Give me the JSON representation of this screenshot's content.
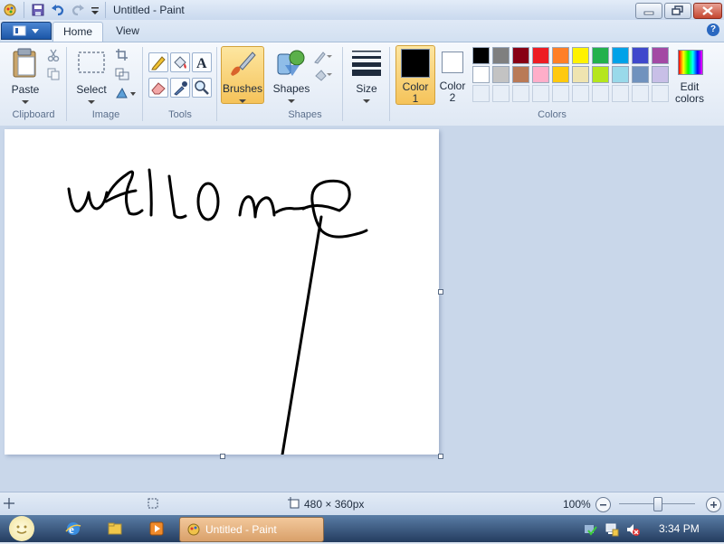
{
  "window": {
    "title": "Untitled - Paint"
  },
  "tabs": [
    {
      "label": "Home",
      "active": true
    },
    {
      "label": "View",
      "active": false
    }
  ],
  "ribbon": {
    "clipboard": {
      "paste_label": "Paste",
      "group_label": "Clipboard"
    },
    "image": {
      "select_label": "Select",
      "group_label": "Image"
    },
    "tools": {
      "group_label": "Tools"
    },
    "brushes": {
      "label": "Brushes"
    },
    "shapes": {
      "label": "Shapes",
      "group_label": "Shapes"
    },
    "size": {
      "label": "Size"
    },
    "colors": {
      "color1_label": "Color",
      "color1_num": "1",
      "color2_label": "Color",
      "color2_num": "2",
      "edit_label_1": "Edit",
      "edit_label_2": "colors",
      "group_label": "Colors",
      "color1_value": "#000000",
      "color2_value": "#ffffff",
      "palette_row1": [
        "#000000",
        "#7f7f7f",
        "#880015",
        "#ed1c24",
        "#ff7f27",
        "#fff200",
        "#22b14c",
        "#00a2e8",
        "#3f48cc",
        "#a349a4"
      ],
      "palette_row2": [
        "#ffffff",
        "#c3c3c3",
        "#b97a57",
        "#ffaec9",
        "#ffc90e",
        "#efe4b0",
        "#b5e61d",
        "#99d9ea",
        "#7092be",
        "#c8bfe7"
      ]
    }
  },
  "canvas": {
    "drawing": "hand-drawn black strokes spelling 'wellome' with a long diagonal line"
  },
  "status": {
    "dimensions": "480 × 360px",
    "zoom": "100%"
  },
  "taskbar": {
    "active_task": "Untitled - Paint",
    "clock": "3:34 PM"
  }
}
